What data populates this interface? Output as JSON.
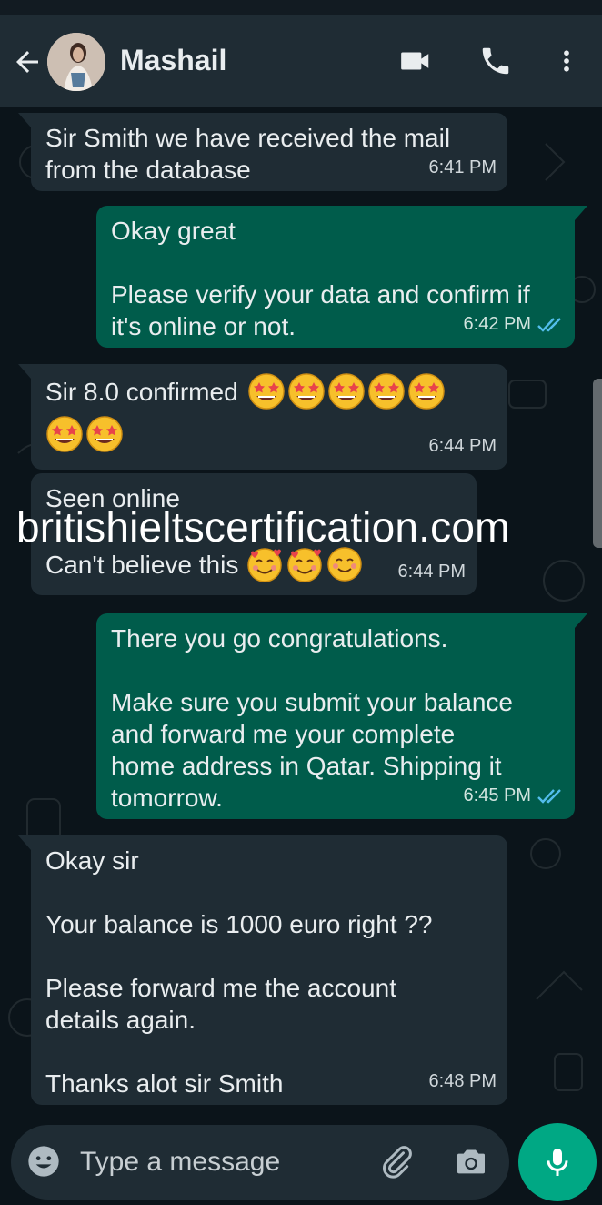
{
  "header": {
    "contact_name": "Mashail",
    "icons": [
      "back-arrow-icon",
      "video-call-icon",
      "voice-call-icon",
      "more-options-icon"
    ]
  },
  "messages": [
    {
      "direction": "in",
      "text": "Sir Smith we have received the mail\nfrom the database",
      "time": "6:41 PM"
    },
    {
      "direction": "out",
      "text": "Okay great\n\nPlease verify your data and confirm if\nit's online or not.",
      "time": "6:42 PM",
      "status": "read"
    },
    {
      "direction": "in",
      "text": "Sir 8.0 confirmed",
      "emoji": [
        "star-struck",
        "star-struck",
        "star-struck",
        "star-struck",
        "star-struck",
        "star-struck",
        "star-struck"
      ],
      "time": "6:44 PM"
    },
    {
      "direction": "in",
      "text_line1": "Seen online",
      "text_line3": "Can't believe this",
      "emoji": [
        "smiling-face-with-hearts",
        "smiling-face-with-hearts",
        "smiling-face"
      ],
      "time": "6:44 PM"
    },
    {
      "direction": "out",
      "text": "There you go congratulations.\n\nMake sure you submit your balance\nand forward me your complete\nhome address in Qatar. Shipping it\ntomorrow.",
      "time": "6:45 PM",
      "status": "read"
    },
    {
      "direction": "in",
      "text": "Okay sir\n\nYour balance is 1000 euro right ??\n\nPlease forward me the account\ndetails again.\n\nThanks alot sir Smith",
      "time": "6:48 PM"
    }
  ],
  "watermark": "britishieltscertification.com",
  "composer": {
    "placeholder": "Type a message",
    "icons": [
      "emoji-icon",
      "attach-icon",
      "camera-icon",
      "mic-icon"
    ]
  },
  "colors": {
    "background": "#0b141a",
    "header": "#1f2c34",
    "incoming_bubble": "#1f2c34",
    "outgoing_bubble": "#005c4b",
    "accent": "#00a884",
    "read_tick": "#53bdeb"
  }
}
